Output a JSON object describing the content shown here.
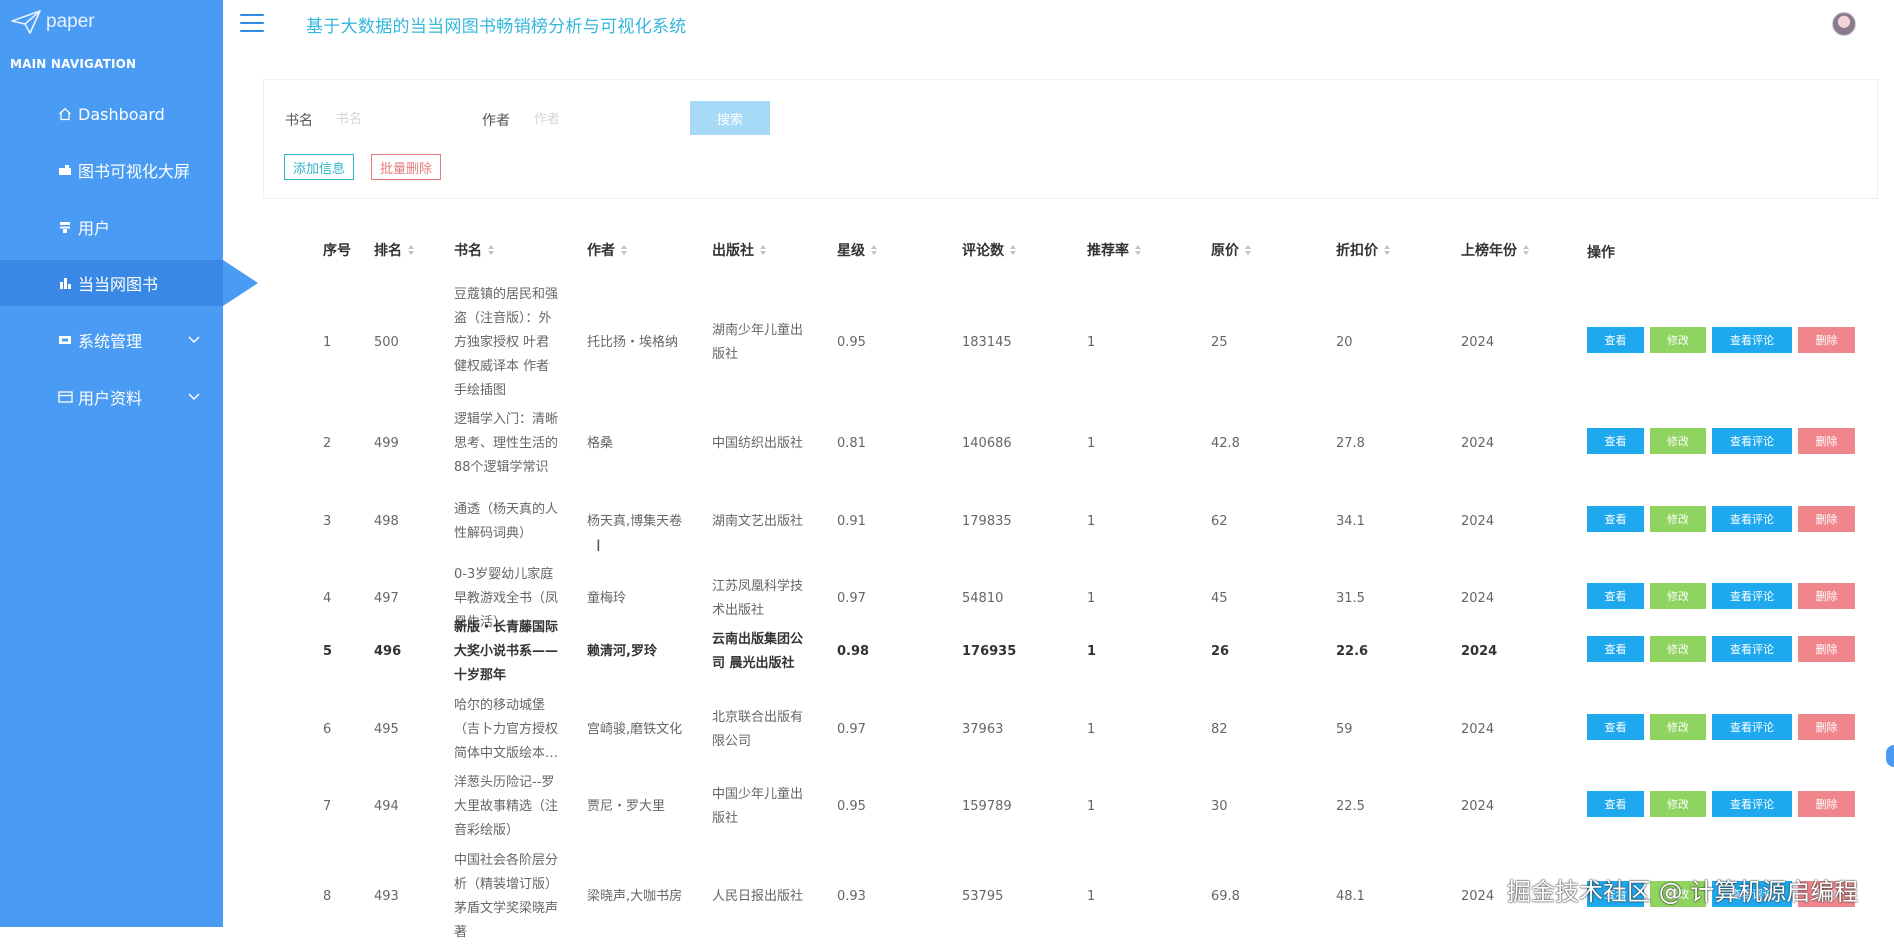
{
  "brand": {
    "name": "paper"
  },
  "app_title": "基于大数据的当当网图书畅销榜分析与可视化系统",
  "sidebar": {
    "heading": "MAIN NAVIGATION",
    "items": [
      {
        "label": "Dashboard",
        "icon": "home-icon"
      },
      {
        "label": "图书可视化大屏",
        "icon": "book-icon"
      },
      {
        "label": "用户",
        "icon": "user-icon"
      },
      {
        "label": "当当网图书",
        "icon": "bar-chart-icon",
        "active": true
      },
      {
        "label": "系统管理",
        "icon": "settings-icon",
        "expandable": true
      },
      {
        "label": "用户资料",
        "icon": "id-card-icon",
        "expandable": true
      }
    ]
  },
  "search": {
    "title_label": "书名",
    "title_placeholder": "书名",
    "author_label": "作者",
    "author_placeholder": "作者",
    "search_button": "搜索",
    "add_button": "添加信息",
    "batch_delete_button": "批量删除"
  },
  "table": {
    "headers": [
      "序号",
      "排名",
      "书名",
      "作者",
      "出版社",
      "星级",
      "评论数",
      "推荐率",
      "原价",
      "折扣价",
      "上榜年份",
      "操作"
    ],
    "actions": {
      "view": "查看",
      "edit": "修改",
      "comments": "查看评论",
      "delete": "删除"
    },
    "rows": [
      {
        "no": "1",
        "rank": "500",
        "title": [
          "豆蔻镇的居民和强",
          "盗（注音版）：外",
          "方独家授权 叶君",
          "健权威译本 作者",
          "手绘插图"
        ],
        "author": [
          "托比扬・埃格纳"
        ],
        "publisher": [
          "湖南少年儿童出",
          "版社"
        ],
        "stars": "0.95",
        "comments": "183145",
        "rec": "1",
        "price": "25",
        "discount": "20",
        "year": "2024"
      },
      {
        "no": "2",
        "rank": "499",
        "title": [
          "逻辑学入门：清晰",
          "思考、理性生活的",
          "88个逻辑学常识"
        ],
        "author": [
          "格桑"
        ],
        "publisher": [
          "中国纺织出版社"
        ],
        "stars": "0.81",
        "comments": "140686",
        "rec": "1",
        "price": "42.8",
        "discount": "27.8",
        "year": "2024"
      },
      {
        "no": "3",
        "rank": "498",
        "title": [
          "通透（杨天真的人",
          "性解码词典）"
        ],
        "author": [
          "杨天真,博集天卷"
        ],
        "publisher": [
          "湖南文艺出版社"
        ],
        "stars": "0.91",
        "comments": "179835",
        "rec": "1",
        "price": "62",
        "discount": "34.1",
        "year": "2024"
      },
      {
        "no": "4",
        "rank": "497",
        "title": [
          "0-3岁婴幼儿家庭",
          "早教游戏全书（凤",
          "凰生活）"
        ],
        "author": [
          "童梅玲"
        ],
        "publisher": [
          "江苏凤凰科学技",
          "术出版社"
        ],
        "stars": "0.97",
        "comments": "54810",
        "rec": "1",
        "price": "45",
        "discount": "31.5",
        "year": "2024"
      },
      {
        "no": "5",
        "rank": "496",
        "title": [
          "新版・长青藤国际",
          "大奖小说书系——",
          "十岁那年"
        ],
        "author": [
          "赖清河,罗玲"
        ],
        "publisher": [
          "云南出版集团公",
          "司 晨光出版社"
        ],
        "stars": "0.98",
        "comments": "176935",
        "rec": "1",
        "price": "26",
        "discount": "22.6",
        "year": "2024"
      },
      {
        "no": "6",
        "rank": "495",
        "title": [
          "哈尔的移动城堡",
          "（吉卜力官方授权",
          "简体中文版绘本…"
        ],
        "author": [
          "宫崎骏,磨铁文化"
        ],
        "publisher": [
          "北京联合出版有",
          "限公司"
        ],
        "stars": "0.97",
        "comments": "37963",
        "rec": "1",
        "price": "82",
        "discount": "59",
        "year": "2024"
      },
      {
        "no": "7",
        "rank": "494",
        "title": [
          "洋葱头历险记--罗",
          "大里故事精选（注",
          "音彩绘版）"
        ],
        "author": [
          "贾尼・罗大里"
        ],
        "publisher": [
          "中国少年儿童出",
          "版社"
        ],
        "stars": "0.95",
        "comments": "159789",
        "rec": "1",
        "price": "30",
        "discount": "22.5",
        "year": "2024"
      },
      {
        "no": "8",
        "rank": "493",
        "title": [
          "中国社会各阶层分",
          "析（精装增订版）",
          "茅盾文学奖梁晓声",
          "著"
        ],
        "author": [
          "梁晓声,大咖书房"
        ],
        "publisher": [
          "人民日报出版社"
        ],
        "stars": "0.93",
        "comments": "53795",
        "rec": "1",
        "price": "69.8",
        "discount": "48.1",
        "year": "2024"
      }
    ]
  },
  "watermark": "掘金技术社区 @ 计算机源启编程",
  "colors": {
    "sidebar": "#4a9bf3",
    "accent": "#1ea9ef",
    "edit": "#8fd360",
    "danger": "#f0868c",
    "title": "#34b7dc"
  }
}
